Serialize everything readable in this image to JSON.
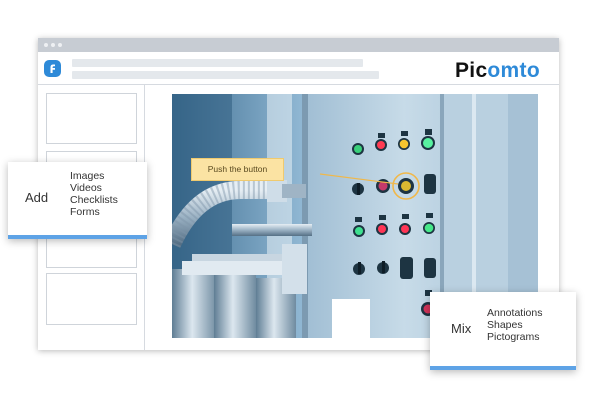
{
  "brand": {
    "name_part1": "Pic",
    "name_part2": "omto",
    "color_dark": "#111111",
    "color_accent": "#2e8ad8",
    "app_icon": "picomto-app-icon"
  },
  "photo": {
    "subject": "industrial control panel with indicator lights and switches",
    "callout_text": "Push the button"
  },
  "add_card": {
    "title": "Add",
    "items": [
      "Images",
      "Videos",
      "Checklists",
      "Forms"
    ]
  },
  "mix_card": {
    "title": "Mix",
    "items": [
      "Annotations",
      "Shapes",
      "Pictograms"
    ]
  },
  "colors": {
    "card_accent_bar": "#5ea3e6",
    "callout_fill": "#fbe3a3",
    "highlight_ring": "#f0b84a"
  }
}
